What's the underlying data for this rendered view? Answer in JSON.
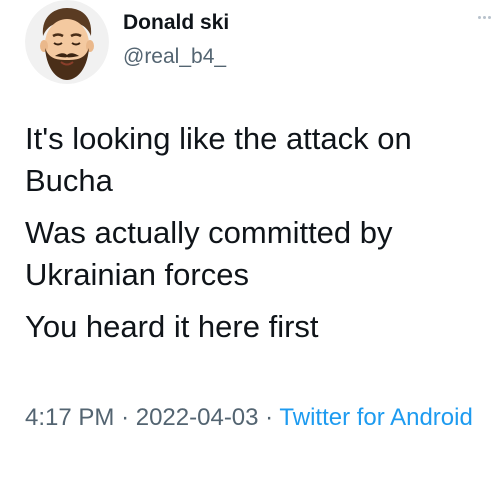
{
  "tweet": {
    "author": {
      "display_name": "Donald ski",
      "handle": "@real_b4_",
      "avatar_icon": "bearded-man-emoji-avatar"
    },
    "more_icon": "more-options-icon",
    "body_lines": [
      "It's looking like the attack on Bucha",
      "Was actually committed by Ukrainian forces",
      "You heard it here first"
    ],
    "meta": {
      "time": "4:17 PM",
      "separator": "·",
      "date": "2022-04-03",
      "source": "Twitter for Android"
    },
    "colors": {
      "text": "#0f1419",
      "secondary": "#536471",
      "link": "#1d9bf0"
    }
  }
}
